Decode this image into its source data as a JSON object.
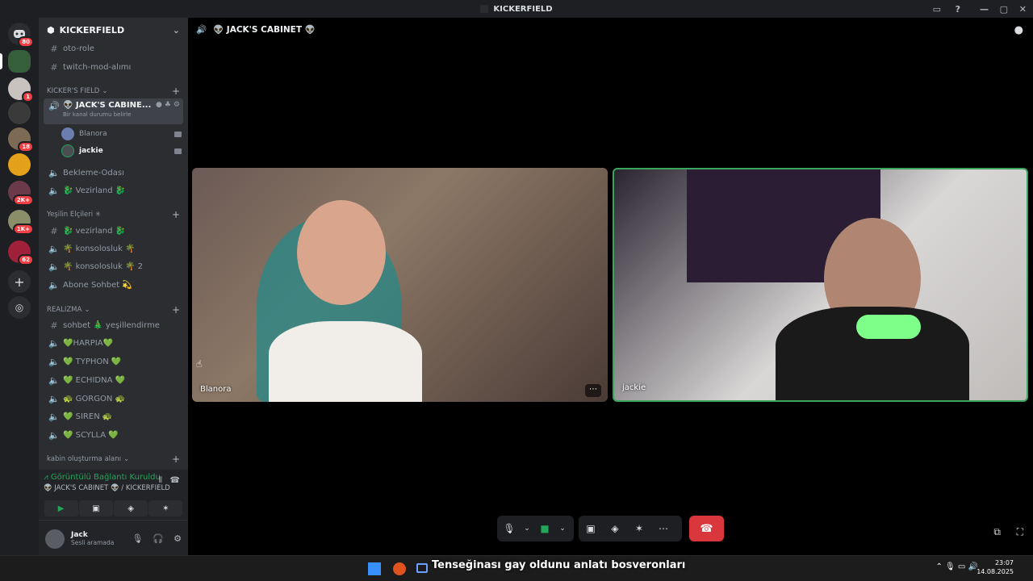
{
  "window": {
    "title": "KICKERFIELD"
  },
  "server_rail": {
    "badges": [
      "80",
      "1",
      "18",
      "2K+",
      "1K+",
      "62"
    ]
  },
  "server": {
    "name": "KICKERFIELD",
    "top_channels": [
      {
        "name": "oto-role"
      },
      {
        "name": "twitch-mod-alımı"
      }
    ],
    "categories": [
      {
        "name": "KICKER'S FIELD"
      },
      {
        "name": "Yeşilin Elçileri ✳"
      },
      {
        "name": "REALIZMA"
      },
      {
        "name": "kabin oluşturma alanı"
      }
    ],
    "active_voice": {
      "name": "👽 JACK'S CABINE...",
      "status_placeholder": "Bir kanal durumu belirle",
      "users": [
        {
          "name": "Blanora"
        },
        {
          "name": "jackie"
        }
      ]
    },
    "kickers_channels": [
      {
        "name": "Bekleme-Odası"
      },
      {
        "name": "🐉 Vezirland 🐉"
      }
    ],
    "yesil_channels": [
      {
        "name": "🐉 vezirland 🐉"
      },
      {
        "name": "🌴 konsolosluk 🌴"
      },
      {
        "name": "🌴 konsolosluk 🌴 2"
      },
      {
        "name": "Abone Sohbet 💫"
      }
    ],
    "realizma_channels": [
      {
        "name": "sohbet 🎄 yeşillendirme"
      },
      {
        "name": "💚HARPIA💚"
      },
      {
        "name": "💚 TYPHON 💚"
      },
      {
        "name": "💚 ECHIDNA 💚"
      },
      {
        "name": "🐢 GORGON 🐢"
      },
      {
        "name": "💚 SIREN 🐢"
      },
      {
        "name": "💚 SCYLLA 💚"
      }
    ]
  },
  "connection": {
    "status": "Görüntülü Bağlantı Kuruldu",
    "channel": "👽 JACK'S CABINET 👽 / KICKERFIELD"
  },
  "user": {
    "name": "Jack",
    "status": "Sesli aramada"
  },
  "stage": {
    "title": "👽 JACK'S CABINET 👽",
    "tiles": [
      {
        "name": "Blanora"
      },
      {
        "name": "jackie"
      }
    ]
  },
  "taskbar": {
    "subtitle": "Tenseğinası gay oldunu anlatı bosveronları",
    "time": "23:07",
    "date": "14.08.2025"
  },
  "colors": {
    "accent_green": "#23a55a",
    "end_call_red": "#da373c",
    "speaking_border": "#3ba55d"
  }
}
